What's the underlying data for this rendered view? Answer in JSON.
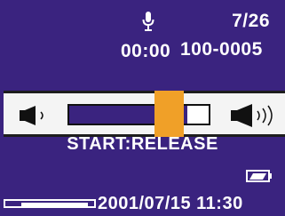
{
  "header": {
    "track_counter": "7/26",
    "elapsed_time": "00:00",
    "file_id": "100-0005",
    "status_icon": "microphone-icon"
  },
  "volume": {
    "level": 0.85,
    "left_icon": "speaker-low-icon",
    "right_icon": "speaker-high-icon"
  },
  "mode": {
    "label": "START:RELEASE"
  },
  "status": {
    "datetime": "2001/07/15 11:30",
    "battery_icon": "battery-icon",
    "battery_level": 0.7,
    "scroll_position": 0.75
  },
  "colors": {
    "background": "#3a237f",
    "accent": "#f0a028",
    "panel": "#f4f4f4"
  }
}
